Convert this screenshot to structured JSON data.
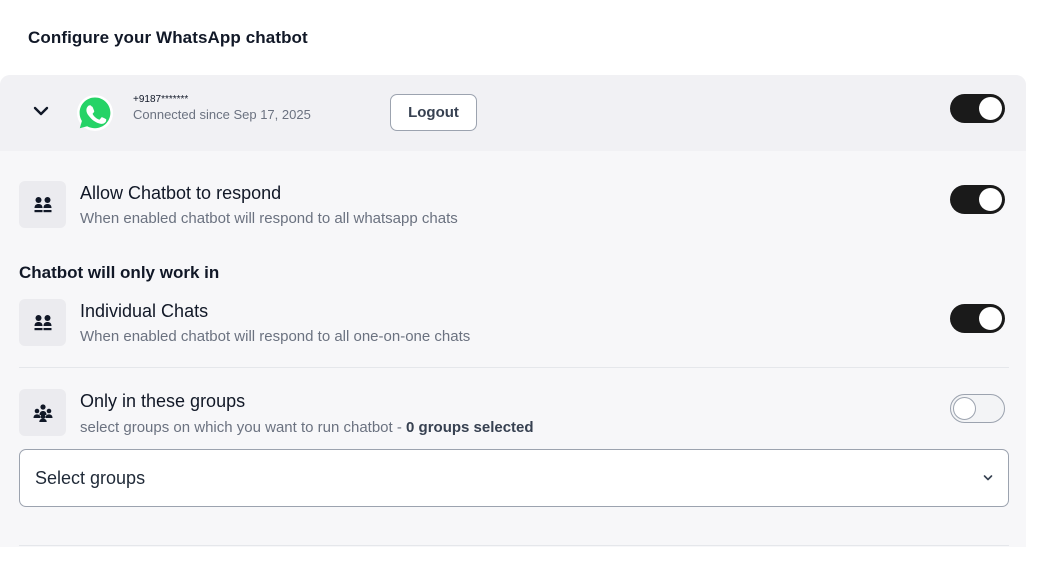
{
  "page": {
    "title": "Configure your WhatsApp chatbot"
  },
  "account": {
    "phone": "+9187*******",
    "connected_since": "Connected since Sep 17, 2025",
    "logout_label": "Logout",
    "enabled": true
  },
  "settings": {
    "allow_chatbot": {
      "title": "Allow Chatbot to respond",
      "description": "When enabled chatbot will respond to all whatsapp chats",
      "enabled": true
    },
    "section_heading": "Chatbot will only work in",
    "individual_chats": {
      "title": "Individual Chats",
      "description": "When enabled chatbot will respond to all one-on-one chats",
      "enabled": true
    },
    "groups": {
      "title": "Only in these groups",
      "description_prefix": "select groups on which you want to run chatbot - ",
      "selected_count_text": "0 groups selected",
      "enabled": false,
      "select_placeholder": "Select groups"
    }
  },
  "icons": {
    "chevron": "chevron-down-icon",
    "whatsapp": "whatsapp-logo-icon",
    "chat_users": "chat-users-icon",
    "group_users": "group-users-icon"
  },
  "colors": {
    "whatsapp_green": "#25d366",
    "toggle_on": "#1a1a1a",
    "panel_bg": "#f7f7f9",
    "header_bg": "#f1f1f4"
  }
}
